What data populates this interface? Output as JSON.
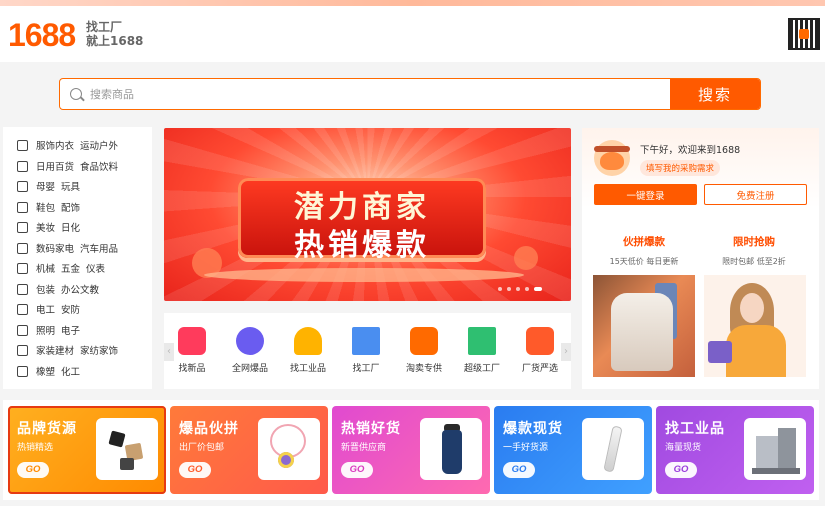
{
  "header": {
    "logo": "1688",
    "slogan_line1": "找工厂",
    "slogan_line2": "就上1688"
  },
  "search": {
    "placeholder": "搜索商品",
    "button_label": "搜索"
  },
  "categories": [
    {
      "icon": "shirt-icon",
      "items": [
        "服饰内衣",
        "运动户外"
      ]
    },
    {
      "icon": "basket-icon",
      "items": [
        "日用百货",
        "食品饮料"
      ]
    },
    {
      "icon": "baby-icon",
      "items": [
        "母婴",
        "玩具"
      ]
    },
    {
      "icon": "shoe-icon",
      "items": [
        "鞋包",
        "配饰"
      ]
    },
    {
      "icon": "cosmetics-icon",
      "items": [
        "美妆",
        "日化"
      ]
    },
    {
      "icon": "camera-icon",
      "items": [
        "数码家电",
        "汽车用品"
      ]
    },
    {
      "icon": "gear-icon",
      "items": [
        "机械",
        "五金",
        "仪表"
      ]
    },
    {
      "icon": "package-icon",
      "items": [
        "包装",
        "办公文教"
      ]
    },
    {
      "icon": "electric-icon",
      "items": [
        "电工",
        "安防"
      ]
    },
    {
      "icon": "lightbulb-icon",
      "items": [
        "照明",
        "电子"
      ]
    },
    {
      "icon": "home-icon",
      "items": [
        "家装建材",
        "家纺家饰"
      ]
    },
    {
      "icon": "flask-icon",
      "items": [
        "橡塑",
        "化工"
      ]
    }
  ],
  "banner": {
    "line1": "潜力商家",
    "line2": "热销爆款"
  },
  "quicknav": [
    {
      "label": "找新品",
      "icon": "new-bag-icon",
      "color": "#ff3b5c"
    },
    {
      "label": "全网爆品",
      "icon": "plane-icon",
      "color": "#6a5cf0"
    },
    {
      "label": "找工业品",
      "icon": "helmet-icon",
      "color": "#ffb300"
    },
    {
      "label": "找工厂",
      "icon": "factory-icon",
      "color": "#4a8ef0"
    },
    {
      "label": "淘卖专供",
      "icon": "tao-icon",
      "color": "#ff6a00"
    },
    {
      "label": "超级工厂",
      "icon": "buildings-icon",
      "color": "#2fbf71"
    },
    {
      "label": "厂货严选",
      "icon": "new-shop-icon",
      "color": "#ff5a2a"
    }
  ],
  "user": {
    "greeting": "下午好，欢迎来到1688",
    "demand_link": "填写我的采购需求",
    "login_label": "一键登录",
    "register_label": "免费注册"
  },
  "promos": [
    {
      "title": "伙拼爆款",
      "subtitle": "15天低价 每日更新"
    },
    {
      "title": "限时抢购",
      "subtitle": "限时包邮 低至2折"
    }
  ],
  "cards": [
    {
      "title": "品牌货源",
      "subtitle": "热销精选",
      "go": "GO",
      "color_from": "#ffb020",
      "color_to": "#ff8a00",
      "go_color": "#ff8a00"
    },
    {
      "title": "爆品伙拼",
      "subtitle": "出厂价包邮",
      "go": "GO",
      "color_from": "#ff7a3a",
      "color_to": "#ff5a4a",
      "go_color": "#ff5a2a"
    },
    {
      "title": "热销好货",
      "subtitle": "新晋供应商",
      "go": "GO",
      "color_from": "#e04ad0",
      "color_to": "#ff6ab0",
      "go_color": "#d93bbf"
    },
    {
      "title": "爆款现货",
      "subtitle": "一手好货源",
      "go": "GO",
      "color_from": "#2a7cf0",
      "color_to": "#40a0ff",
      "go_color": "#2a7cf0"
    },
    {
      "title": "找工业品",
      "subtitle": "海量现货",
      "go": "GO",
      "color_from": "#a04ae0",
      "color_to": "#c060f0",
      "go_color": "#9a3ddb"
    }
  ]
}
